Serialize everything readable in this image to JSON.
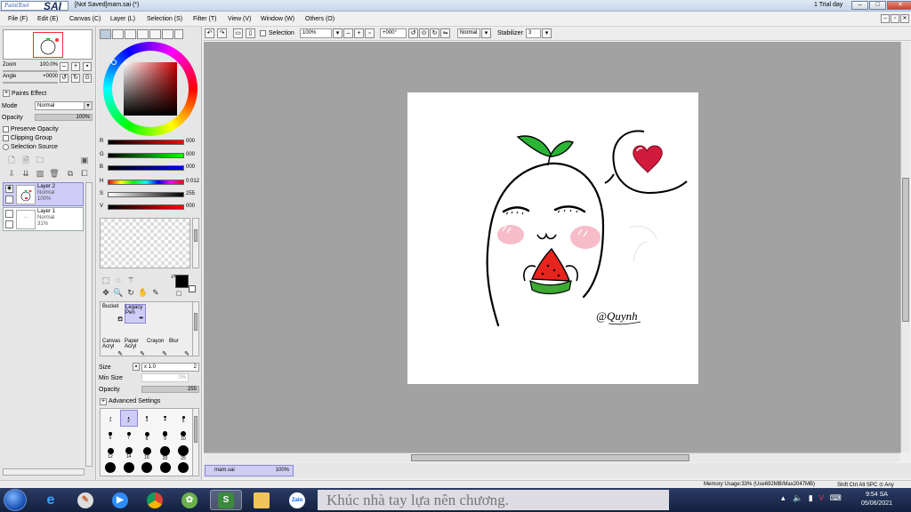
{
  "window": {
    "logo_small": "PaintTool",
    "logo_big": "SAI",
    "title": "[Not Saved]mam.sai (*)",
    "trial": "1 Trial day"
  },
  "menu": [
    "File (F)",
    "Edit (E)",
    "Canvas (C)",
    "Layer (L)",
    "Selection (S)",
    "Filter (T)",
    "View (V)",
    "Window (W)",
    "Others (O)"
  ],
  "navigator": {
    "zoom_label": "Zoom",
    "zoom_value": "100.0%",
    "angle_label": "Angle",
    "angle_value": "+0000"
  },
  "layer_panel": {
    "paints_effect": "Paints Effect",
    "mode_label": "Mode",
    "mode_value": "Normal",
    "opacity_label": "Opacity",
    "opacity_value": "100%",
    "preserve_opacity": "Preserve Opacity",
    "clipping_group": "Clipping Group",
    "selection_source": "Selection Source",
    "layers": [
      {
        "name": "Layer 2",
        "mode": "Normal",
        "opacity": "100%"
      },
      {
        "name": "Layer 1",
        "mode": "Normal",
        "opacity": "31%"
      }
    ]
  },
  "color": {
    "r_label": "R",
    "r_value": "000",
    "g_label": "G",
    "g_value": "000",
    "b_label": "B",
    "b_value": "000",
    "h_label": "H",
    "h_value": "0:012",
    "s_label": "S",
    "s_value": "255",
    "v_label": "V",
    "v_value": "000",
    "foreground": "#000000",
    "background": "#ffffff"
  },
  "brushes": [
    {
      "top": "Bucket",
      "bottom": ""
    },
    {
      "top": "Legacy",
      "bottom": "Pen"
    },
    {
      "top": "Canvas",
      "bottom": "Acryl"
    },
    {
      "top": "Paper",
      "bottom": "Acryl"
    },
    {
      "top": "Crayon",
      "bottom": ""
    },
    {
      "top": "Blur",
      "bottom": ""
    }
  ],
  "brush_settings": {
    "size_label": "Size",
    "size_mult": "x 1.0",
    "size_value": "2",
    "min_size_label": "Min Size",
    "min_size_value": "0%",
    "opacity_label": "Opacity",
    "opacity_value": "255",
    "advanced": "Advanced Settings"
  },
  "dot_sizes": [
    {
      "label": "1",
      "d": 1
    },
    {
      "label": "2",
      "d": 1.5
    },
    {
      "label": "3",
      "d": 2
    },
    {
      "label": "4",
      "d": 2.5
    },
    {
      "label": "5",
      "d": 3
    },
    {
      "label": "6",
      "d": 3.5
    },
    {
      "label": "7",
      "d": 4
    },
    {
      "label": "8",
      "d": 5
    },
    {
      "label": "9",
      "d": 5.5
    },
    {
      "label": "10",
      "d": 6
    },
    {
      "label": "12",
      "d": 7
    },
    {
      "label": "14",
      "d": 8
    },
    {
      "label": "16",
      "d": 9
    },
    {
      "label": "20",
      "d": 11
    },
    {
      "label": "25",
      "d": 12
    },
    {
      "label": "",
      "d": 12
    },
    {
      "label": "",
      "d": 12
    },
    {
      "label": "",
      "d": 12
    },
    {
      "label": "",
      "d": 12
    },
    {
      "label": "",
      "d": 12
    }
  ],
  "toolbar": {
    "selection_label": "Selection",
    "zoom_value": "100%",
    "angle_value": "+000°",
    "blend_value": "Normal",
    "stabilizer_label": "Stabilizer",
    "stabilizer_value": "3"
  },
  "canvas": {
    "signature": "@Quynh"
  },
  "doc_tab": {
    "name": "mam.sai",
    "zoom": "100%"
  },
  "status": {
    "memory": "Memory Usage:33% (Use692MB/Max2047MB)",
    "keys": "Shift Ctrl Alt SPC ⊙ Any"
  },
  "taskbar": {
    "news": "Khúc nhà tay lựa nên chương.",
    "time": "9:54 SA",
    "date": "05/06/2021"
  }
}
